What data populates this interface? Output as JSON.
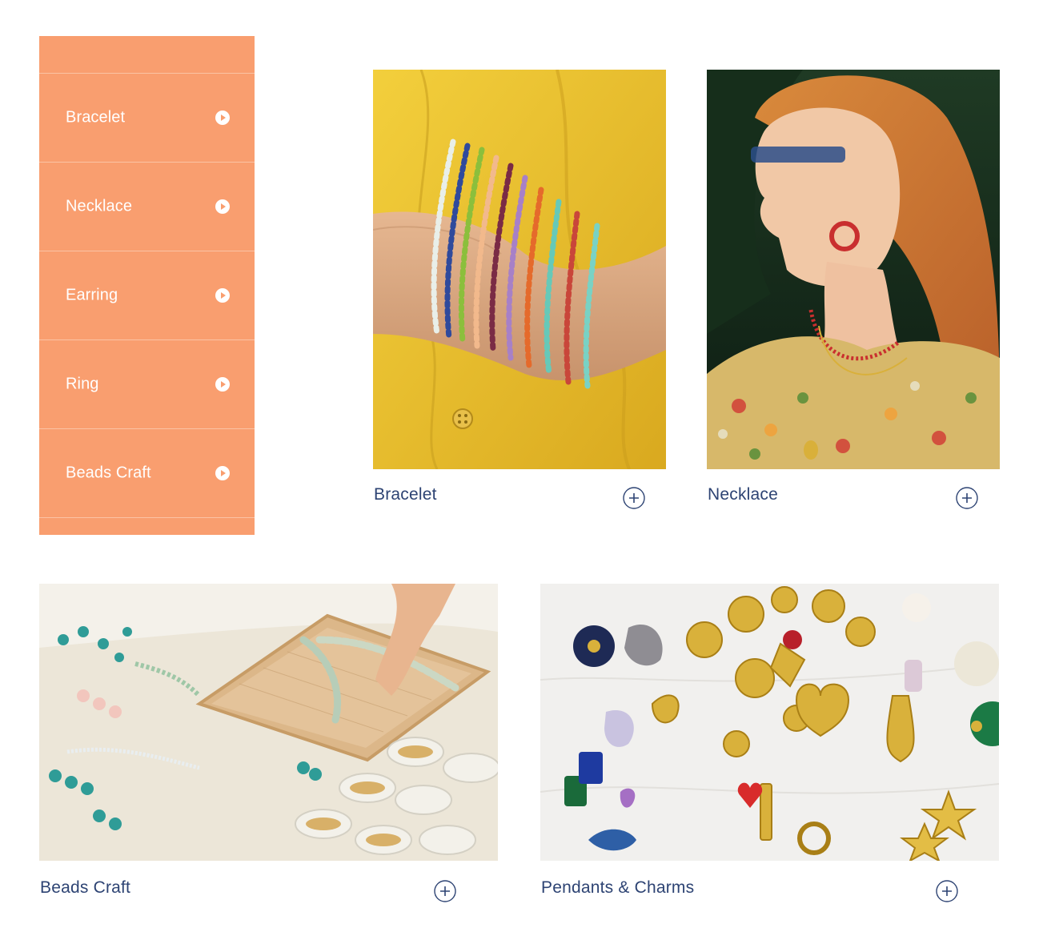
{
  "menu": {
    "items": [
      {
        "label": "Bracelet"
      },
      {
        "label": "Necklace"
      },
      {
        "label": "Earring"
      },
      {
        "label": "Ring"
      },
      {
        "label": "Beads Craft"
      }
    ],
    "icon": "play-circle-icon"
  },
  "cards": {
    "bracelet": {
      "title": "Bracelet",
      "icon": "plus-circle-icon"
    },
    "necklace": {
      "title": "Necklace",
      "icon": "plus-circle-icon"
    },
    "beads_craft": {
      "title": "Beads Craft",
      "icon": "plus-circle-icon"
    },
    "pendants_charms": {
      "title": "Pendants & Charms",
      "icon": "plus-circle-icon"
    }
  },
  "colors": {
    "menu_background": "#f99e6f",
    "menu_text": "#ffffff",
    "card_title": "#2d4373",
    "icon_stroke": "#2d4373"
  }
}
